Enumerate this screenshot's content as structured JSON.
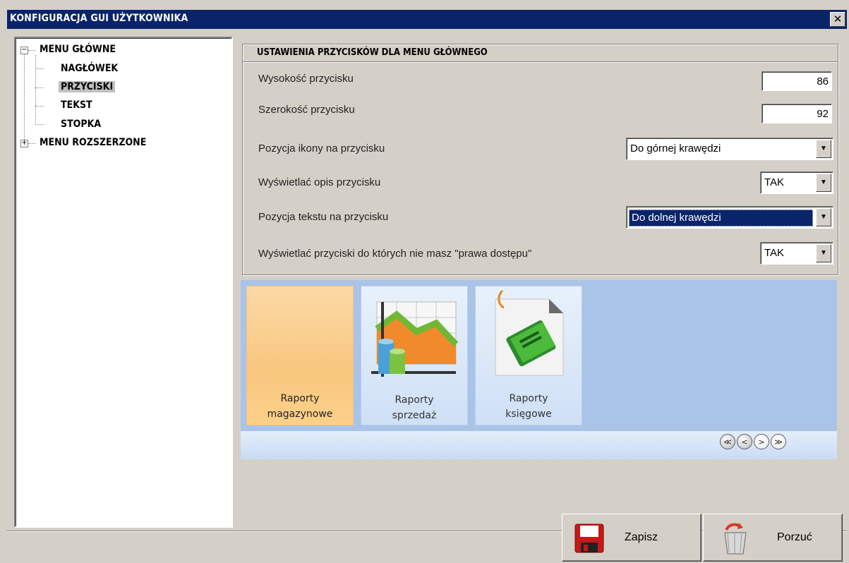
{
  "window": {
    "title": "KONFIGURACJA GUI UŻYTKOWNIKA",
    "close_glyph": "✕"
  },
  "tree": {
    "main": {
      "expander": "−",
      "label": "MENU GŁÓWNE"
    },
    "children": [
      "NAGŁÓWEK",
      "PRZYCISKI",
      "TEKST",
      "STOPKA"
    ],
    "selected": "PRZYCISKI",
    "extended": {
      "expander": "+",
      "label": "MENU ROZSZERZONE"
    }
  },
  "settings": {
    "header": "USTAWIENIA PRZYCISKÓW DLA MENU GŁÓWNEGO",
    "button_height": {
      "label": "Wysokość przycisku",
      "value": "86"
    },
    "button_width": {
      "label": "Szerokość przycisku",
      "value": "92"
    },
    "icon_position": {
      "label": "Pozycja ikony na przycisku",
      "value": "Do górnej krawędzi"
    },
    "show_description": {
      "label": "Wyświetlać opis przycisku",
      "value": "TAK"
    },
    "text_position": {
      "label": "Pozycja tekstu na przycisku",
      "value": "Do dolnej krawędzi"
    },
    "show_unauthorized": {
      "label": "Wyświetlać przyciski do których nie masz \"prawa dostępu\"",
      "value": "TAK"
    }
  },
  "preview": {
    "buttons": [
      {
        "line1": "Raporty",
        "line2": "magazynowe",
        "icon": "blank",
        "active": true
      },
      {
        "line1": "Raporty",
        "line2": "sprzedaż",
        "icon": "chart-icon",
        "active": false
      },
      {
        "line1": "Raporty",
        "line2": "księgowe",
        "icon": "green-book-icon",
        "active": false
      }
    ],
    "nav": [
      "≪",
      "<",
      ">",
      "≫"
    ]
  },
  "footer": {
    "save_label": "Zapisz",
    "cancel_label": "Porzuć"
  },
  "colors": {
    "titlebar": "#0a246a",
    "dialog": "#d4d0c8",
    "preview_bg": "#a9c4e8",
    "active_button": "#f9c77e"
  }
}
